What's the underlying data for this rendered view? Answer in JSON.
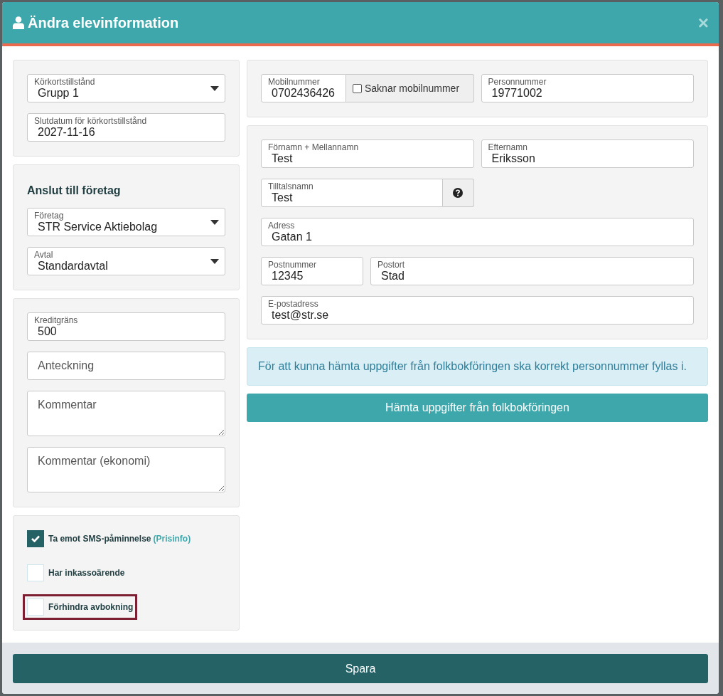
{
  "dialog": {
    "title": "Ändra elevinformation",
    "close": "×"
  },
  "left_panels": [
    {
      "items": [
        {
          "kind": "select",
          "label": "Körkortstillstånd",
          "value": "Grupp 1"
        },
        {
          "kind": "input",
          "label": "Slutdatum för körkortstillstånd",
          "value": "2027-11-16"
        }
      ]
    },
    {
      "items": [
        {
          "kind": "heading",
          "text": "Anslut till företag"
        },
        {
          "kind": "select",
          "label": "Företag",
          "value": "STR Service Aktiebolag"
        },
        {
          "kind": "select",
          "label": "Avtal",
          "value": "Standardavtal"
        }
      ]
    },
    {
      "items": [
        {
          "kind": "input",
          "label": "Kreditgräns",
          "value": "500"
        },
        {
          "kind": "input",
          "placeholder": "Anteckning"
        },
        {
          "kind": "textarea",
          "placeholder": "Kommentar"
        },
        {
          "kind": "textarea",
          "placeholder": "Kommentar (ekonomi)"
        }
      ]
    },
    {
      "items": [
        {
          "kind": "checkbox",
          "label": "Ta emot SMS-påminnelse",
          "link": "(Prisinfo)",
          "checked": true,
          "highlighted": false
        },
        {
          "kind": "checkbox",
          "label": "Har inkassoärende",
          "checked": false,
          "highlighted": false
        },
        {
          "kind": "checkbox",
          "label": "Förhindra avbokning",
          "checked": false,
          "highlighted": true
        }
      ]
    }
  ],
  "right_panels": [
    {
      "rows": [
        [
          {
            "kind": "phone",
            "label": "Mobilnummer",
            "value": "0702436426",
            "addon_label": "Saknar mobilnummer",
            "addon_checked": false
          },
          {
            "kind": "input",
            "label": "Personnummer",
            "value": "19771002"
          }
        ]
      ]
    },
    {
      "rows": [
        [
          {
            "kind": "input",
            "label": "Förnamn + Mellannamn",
            "value": "Test"
          },
          {
            "kind": "input",
            "label": "Efternamn",
            "value": "Eriksson"
          }
        ],
        [
          {
            "kind": "help",
            "label": "Tilltalsnamn",
            "value": "Test"
          }
        ],
        [
          {
            "kind": "input",
            "label": "Adress",
            "value": "Gatan 1"
          }
        ],
        [
          {
            "kind": "short",
            "label": "Postnummer",
            "value": "12345"
          },
          {
            "kind": "input",
            "label": "Postort",
            "value": "Stad"
          }
        ],
        [
          {
            "kind": "input",
            "label": "E-postadress",
            "value": "test@str.se"
          }
        ]
      ]
    }
  ],
  "info": "För att kunna hämta uppgifter från folkbokföringen ska korrekt personnummer fyllas i.",
  "fetch_button": "Hämta uppgifter från folkbokföringen",
  "save_button": "Spara"
}
